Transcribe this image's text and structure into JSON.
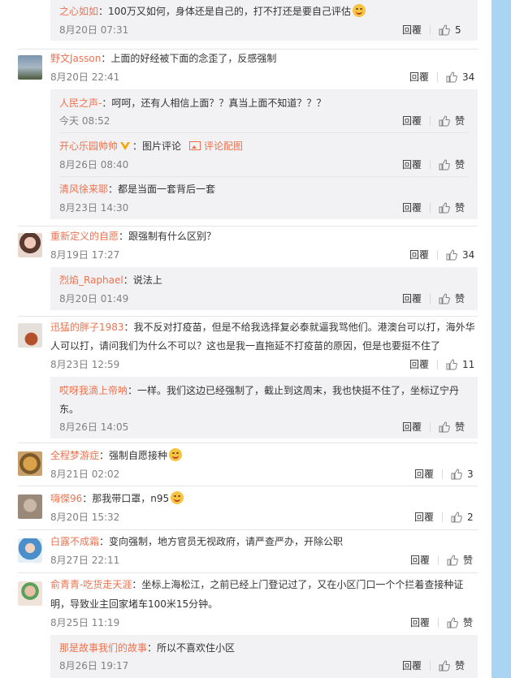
{
  "ui": {
    "reply_label": "回覆",
    "like_icon": "thumbs-up-icon",
    "colors": {
      "username": "#eb7350",
      "reply_bg": "#f2f2f5",
      "side_panel": "#a9d4f2",
      "time": "#808080"
    }
  },
  "comments": [
    {
      "user": "之心如如",
      "text": "100万又如何，身体还是自己的，打不打还是要自己评估",
      "emoji": true,
      "time": "8月20日 07:31",
      "likes": "5"
    },
    {
      "user": "野文Jasson",
      "text": "上面的好经被下面的念歪了，反感强制",
      "time": "8月20日 22:41",
      "likes": "34"
    },
    {
      "user": "人民之声-",
      "text": "呵呵，还有人相信上面？？真当上面不知道？？？",
      "time": "今天 08:52",
      "likes": "赞"
    },
    {
      "user": "开心乐园帅帅",
      "vip": true,
      "text": "图片评论",
      "extra_link": "评论配图",
      "time": "8月26日 08:40",
      "likes": "赞"
    },
    {
      "user": "清风徐来耶",
      "text": "都是当面一套背后一套",
      "time": "8月23日 14:30",
      "likes": "赞"
    },
    {
      "user": "重新定义的自愿",
      "text": "跟强制有什么区别？",
      "time": "8月19日 17:27",
      "likes": "34"
    },
    {
      "user": "烈焰_Raphael",
      "text": "说法上",
      "time": "8月20日 01:49",
      "likes": "赞"
    },
    {
      "user": "迅猛的胖子1983",
      "text_line1": "我不反对打疫苗，但是不给我选择复必泰就逼我骂他们。港澳台可以打，海外华",
      "text_line2": "人可以打，请问我们为什么不可以？这也是我一直拖延不打疫苗的原因，但是也要挺不住了",
      "time": "8月23日 12:59",
      "likes": "11"
    },
    {
      "user": "哎呀我滴上帝呐",
      "text_line1": "一样。我们这边已经强制了，截止到这周末，我也快挺不住了，坐标辽宁丹",
      "text_line2": "东。",
      "time": "8月26日 14:05",
      "likes": "赞"
    },
    {
      "user": "全程梦游症",
      "text": "强制自愿接种",
      "emoji": true,
      "time": "8月21日 02:02",
      "likes": "3"
    },
    {
      "user": "嗨傑96",
      "text": "那我带口罩，n95",
      "emoji": true,
      "time": "8月20日 15:32",
      "likes": "2"
    },
    {
      "user": "白露不成霜",
      "text": "变向强制，地方官员无视政府，请严查严办，开除公职",
      "time": "8月27日 22:11",
      "likes": "赞"
    },
    {
      "user": "俞青青-吃货走天涯",
      "text_line1": "坐标上海松江，之前已经上门登记过了，又在小区门口一个个拦着查接种证",
      "text_line2": "明，导致业主回家堵车100米15分钟。",
      "time": "8月25日 11:19",
      "likes": "赞"
    },
    {
      "user": "那是故事我们的故事",
      "text": "所以不喜欢住小区",
      "time": "8月26日 19:17",
      "likes": "赞"
    }
  ]
}
